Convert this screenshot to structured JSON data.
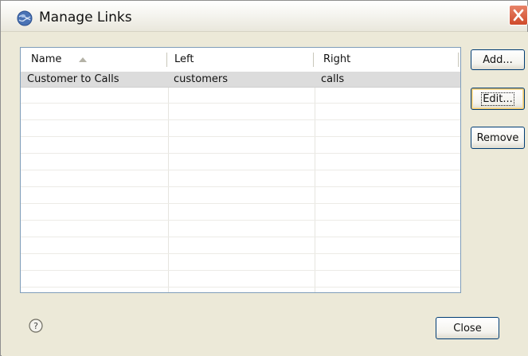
{
  "window": {
    "title": "Manage Links",
    "close_glyph": "✕"
  },
  "table": {
    "columns": [
      {
        "label": "Name",
        "sorted": "ascending"
      },
      {
        "label": "Left"
      },
      {
        "label": "Right"
      }
    ],
    "rows": [
      {
        "name": "Customer to Calls",
        "left": "customers",
        "right": "calls",
        "selected": true
      }
    ]
  },
  "buttons": {
    "add": "Add...",
    "edit": "Edit...",
    "remove": "Remove",
    "close": "Close"
  },
  "icons": {
    "app": "app-globe-icon",
    "help": "help-icon",
    "sort": "sort-ascending-icon",
    "close": "close-icon"
  },
  "colors": {
    "dialog_bg": "#ece9d8",
    "selection": "#dcdcdc",
    "close_button": "#d9593a",
    "button_border": "#003c74"
  }
}
